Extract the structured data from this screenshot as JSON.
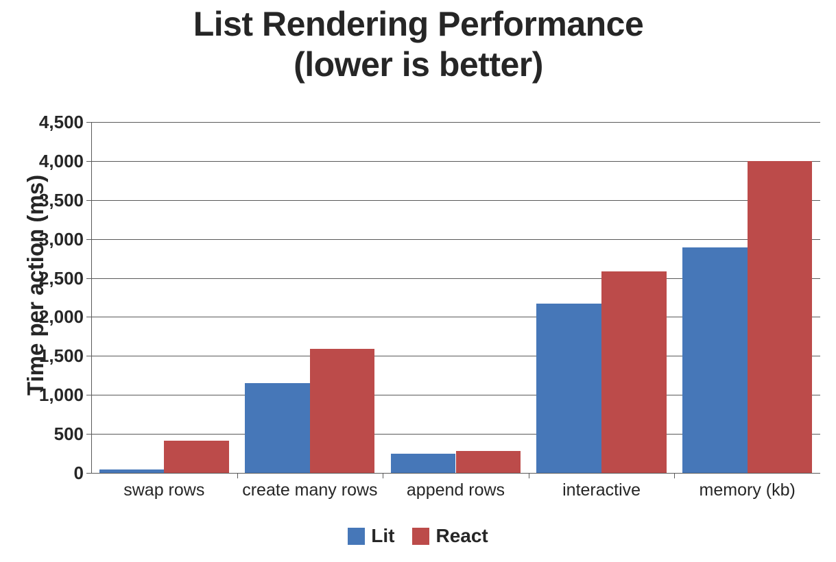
{
  "chart_data": {
    "type": "bar",
    "title": "List Rendering Performance\n(lower is better)",
    "xlabel": "",
    "ylabel": "Time per action (ms)",
    "ylim": [
      0,
      4500
    ],
    "ytick_step": 500,
    "ytick_labels": [
      "4,500",
      "4,000",
      "3,500",
      "3,000",
      "2,500",
      "2,000",
      "1,500",
      "1,000",
      "500",
      "0"
    ],
    "ytick_values": [
      4500,
      4000,
      3500,
      3000,
      2500,
      2000,
      1500,
      1000,
      500,
      0
    ],
    "grid": true,
    "legend_position": "bottom",
    "categories": [
      "swap rows",
      "create many rows",
      "append rows",
      "interactive",
      "memory (kb)"
    ],
    "series": [
      {
        "name": "Lit",
        "color": "#4677B8",
        "values": [
          45,
          1150,
          245,
          2175,
          2895
        ]
      },
      {
        "name": "React",
        "color": "#BC4B4A",
        "values": [
          415,
          1590,
          280,
          2580,
          4000
        ]
      }
    ]
  }
}
